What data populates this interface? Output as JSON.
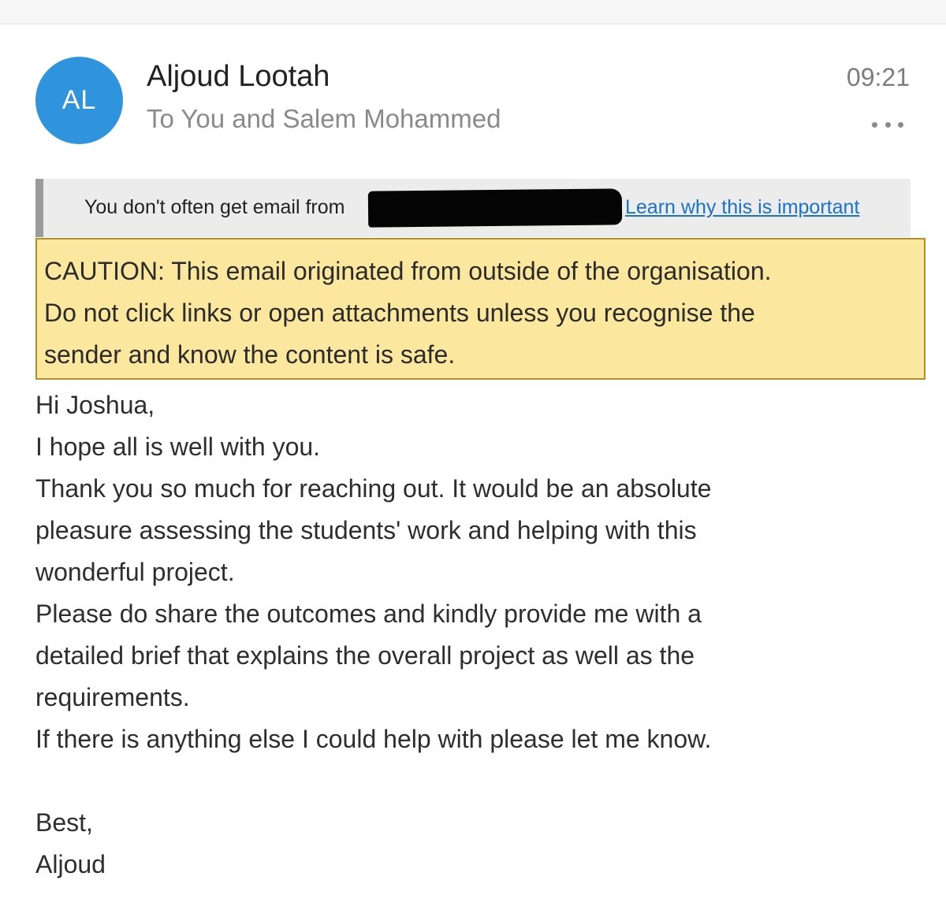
{
  "header": {
    "avatar_initials": "AL",
    "avatar_color": "#2f93de",
    "sender_name": "Aljoud Lootah",
    "recipients": "To You and Salem Mohammed",
    "time": "09:21",
    "more_icon": "ellipsis-icon"
  },
  "notice": {
    "text": "You don't often get email from",
    "redacted": true,
    "link_text": "Learn why this is important"
  },
  "caution": {
    "lines": [
      "CAUTION: This email originated from outside of the organisation.",
      "Do not click links or open attachments unless you recognise the",
      "sender and know the content is safe."
    ],
    "background": "#fbe79d",
    "border": "#b88a2a"
  },
  "body": {
    "lines": [
      "Hi Joshua,",
      "I hope all is well with you.",
      "Thank you so much for reaching out. It would be an absolute",
      "pleasure assessing the students' work and helping with this",
      "wonderful project.",
      "Please do share the outcomes and kindly provide me with a",
      "detailed brief that explains the overall project as well as the",
      "requirements.",
      "If there is anything else I could help with please let me know."
    ],
    "closing": "Best,",
    "signature": "Aljoud"
  }
}
